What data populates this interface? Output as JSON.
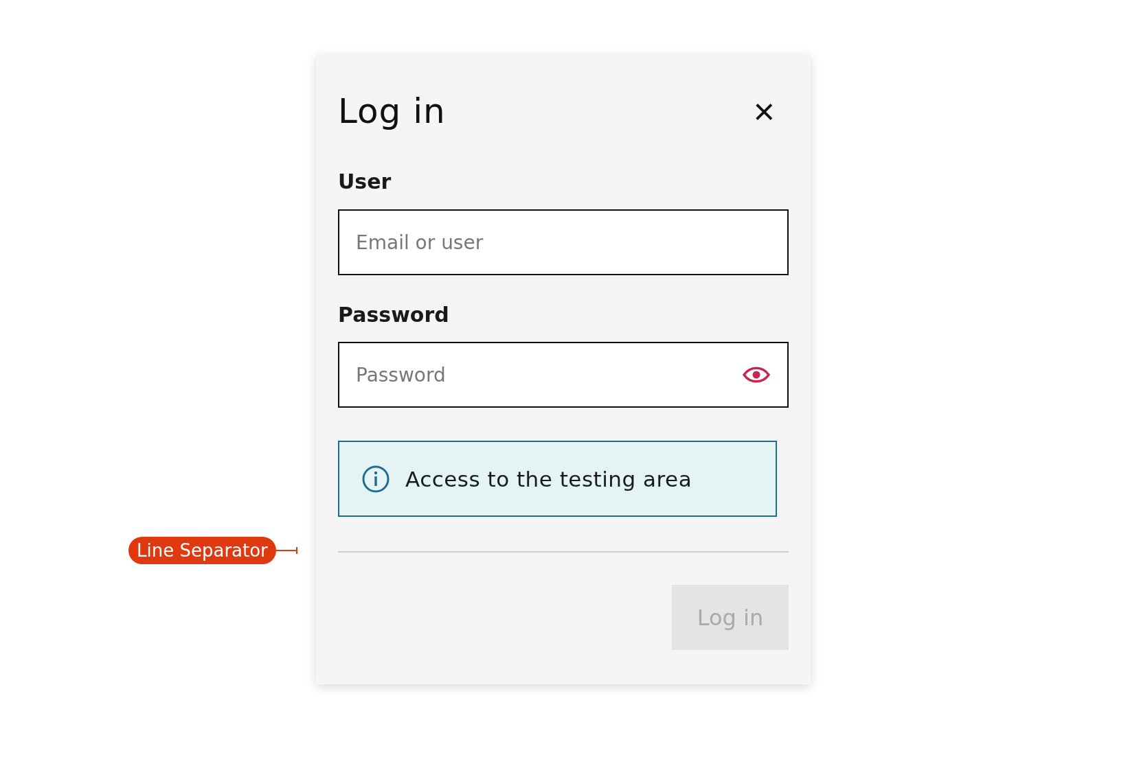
{
  "dialog": {
    "title": "Log in",
    "close_icon": "×"
  },
  "fields": [
    {
      "kind": "text",
      "label": "User",
      "placeholder": "Email or user"
    },
    {
      "kind": "password",
      "label": "Password",
      "placeholder": "Password"
    }
  ],
  "info": {
    "text": "Access to the testing area"
  },
  "submit": {
    "label": "Log in",
    "disabled": true
  },
  "annotation": {
    "label": "Line Separator"
  }
}
